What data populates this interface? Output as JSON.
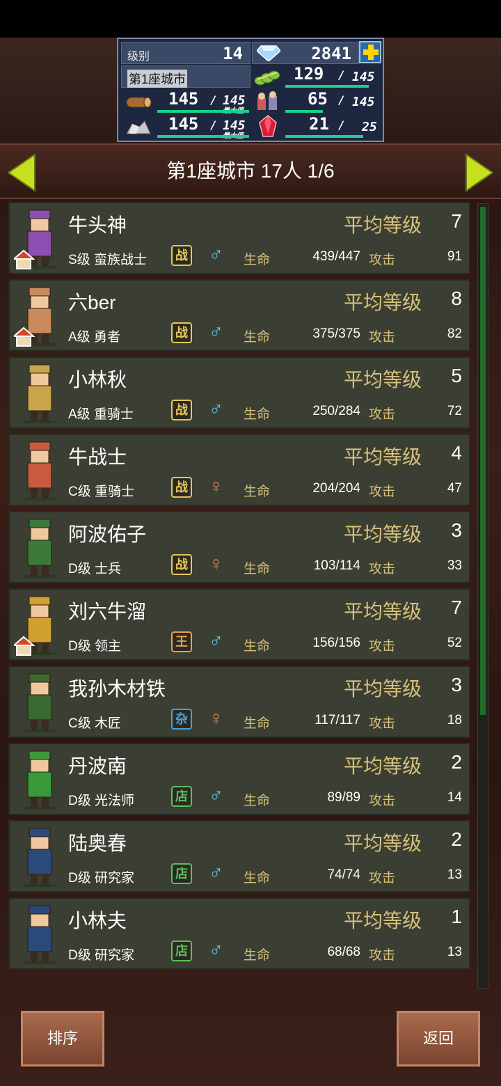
{
  "status": {
    "level_label": "级别",
    "level_value": "14",
    "gems": "2841",
    "city_label": "第1座城市",
    "food_current": "129",
    "food_max": "145",
    "wood_current": "145",
    "wood_max": "145",
    "max_label": "最大值",
    "merchants_current": "65",
    "merchants_max": "145",
    "ore_current": "145",
    "ore_max": "145",
    "crystal_current": "21",
    "crystal_max": "25",
    "slash": "/"
  },
  "header": {
    "title": "第1座城市  17人 1/6"
  },
  "labels": {
    "avg": "平均等级",
    "life": "生命",
    "atk": "攻击"
  },
  "rows": [
    {
      "name": "牛头神",
      "level": "7",
      "cls": "S级 蛮族战士",
      "badge": "战",
      "gender": "male",
      "hp": "439/447",
      "atk": "91",
      "color": "#8a4fb0",
      "home": true
    },
    {
      "name": "六ber",
      "level": "8",
      "cls": "A级 勇者",
      "badge": "战",
      "gender": "male",
      "hp": "375/375",
      "atk": "82",
      "color": "#c98a5b",
      "home": true
    },
    {
      "name": "小林秋",
      "level": "5",
      "cls": "A级 重骑士",
      "badge": "战",
      "gender": "male",
      "hp": "250/284",
      "atk": "72",
      "color": "#c9a44a",
      "home": false
    },
    {
      "name": "牛战士",
      "level": "4",
      "cls": "C级 重骑士",
      "badge": "战",
      "gender": "female",
      "hp": "204/204",
      "atk": "47",
      "color": "#c75a3f",
      "home": false
    },
    {
      "name": "阿波佑子",
      "level": "3",
      "cls": "D级 士兵",
      "badge": "战",
      "gender": "female",
      "hp": "103/114",
      "atk": "33",
      "color": "#3c7a3a",
      "home": false
    },
    {
      "name": "刘六牛溜",
      "level": "7",
      "cls": "D级 领主",
      "badge": "王",
      "gender": "male",
      "hp": "156/156",
      "atk": "52",
      "color": "#d0a030",
      "home": true
    },
    {
      "name": "我孙木材铁",
      "level": "3",
      "cls": "C级 木匠",
      "badge": "杂",
      "gender": "female",
      "hp": "117/117",
      "atk": "18",
      "color": "#3a6a30",
      "home": false
    },
    {
      "name": "丹波南",
      "level": "2",
      "cls": "D级 光法师",
      "badge": "店",
      "gender": "male",
      "hp": "89/89",
      "atk": "14",
      "color": "#3a9a3a",
      "home": false
    },
    {
      "name": "陆奥春",
      "level": "2",
      "cls": "D级 研究家",
      "badge": "店",
      "gender": "male",
      "hp": "74/74",
      "atk": "13",
      "color": "#2b4a7a",
      "home": false
    },
    {
      "name": "小林夫",
      "level": "1",
      "cls": "D级 研究家",
      "badge": "店",
      "gender": "male",
      "hp": "68/68",
      "atk": "13",
      "color": "#2b4a7a",
      "home": false
    }
  ],
  "buttons": {
    "sort": "排序",
    "back": "返回"
  },
  "colors": {
    "badge_war": "#e6c75a",
    "badge_king": "#e8a050",
    "badge_misc": "#4aa0d8",
    "badge_shop": "#5cc05c",
    "male": "#5ec2f0",
    "female": "#f08a6a",
    "accent_green": "#1bd08a"
  }
}
